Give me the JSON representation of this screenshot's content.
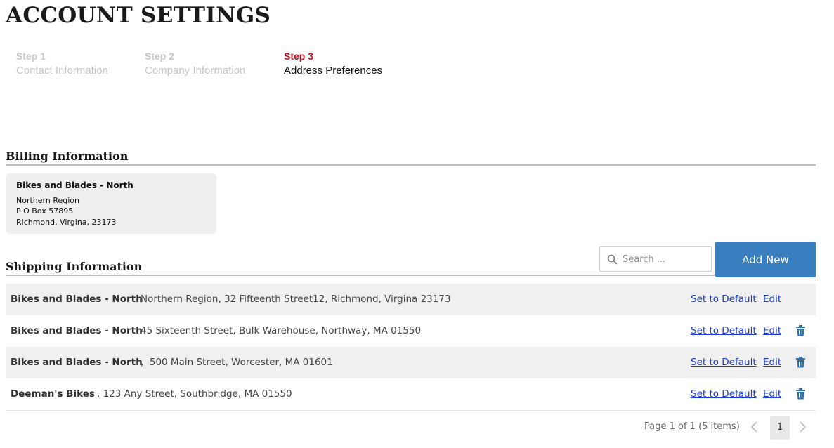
{
  "page": {
    "title": "ACCOUNT SETTINGS"
  },
  "steps": [
    {
      "number": "Step 1",
      "name": "Contact Information",
      "active": false
    },
    {
      "number": "Step 2",
      "name": "Company Information",
      "active": false
    },
    {
      "number": "Step 3",
      "name": "Address Preferences",
      "active": true
    }
  ],
  "billing": {
    "heading": "Billing Information",
    "name": "Bikes and Blades - North",
    "line1": "Northern Region",
    "line2": "P O Box 57895",
    "line3": "Richmond, Virgina, 23173"
  },
  "shipping": {
    "heading": "Shipping Information",
    "search_placeholder": "Search ...",
    "add_new_label": "Add New",
    "set_default_label": "Set to Default",
    "edit_label": "Edit",
    "rows": [
      {
        "name": "Bikes and Blades - North",
        "address": "Northern Region, 32 Fifteenth Street12, Richmond, Virgina 23173",
        "deletable": false
      },
      {
        "name": "Bikes and Blades - North",
        "address": "45 Sixteenth Street, Bulk Warehouse, Northway, MA 01550",
        "deletable": true
      },
      {
        "name": "Bikes and Blades - North",
        "address": ",  500 Main Street, Worcester, MA 01601",
        "deletable": true
      },
      {
        "name": "Deeman's Bikes",
        "address": ", 123 Any Street, Southbridge, MA 01550",
        "deletable": true
      }
    ]
  },
  "pager": {
    "info": "Page 1 of 1 (5 items)",
    "current_page": "1"
  },
  "colors": {
    "accent": "#3a7fc0",
    "active_step": "#c1121f",
    "link": "#1a3fcf",
    "trash": "#2f6fb0"
  },
  "icons": {
    "search": "search-icon",
    "delete": "trash-icon",
    "prev": "chevron-left-icon",
    "next": "chevron-right-icon"
  }
}
